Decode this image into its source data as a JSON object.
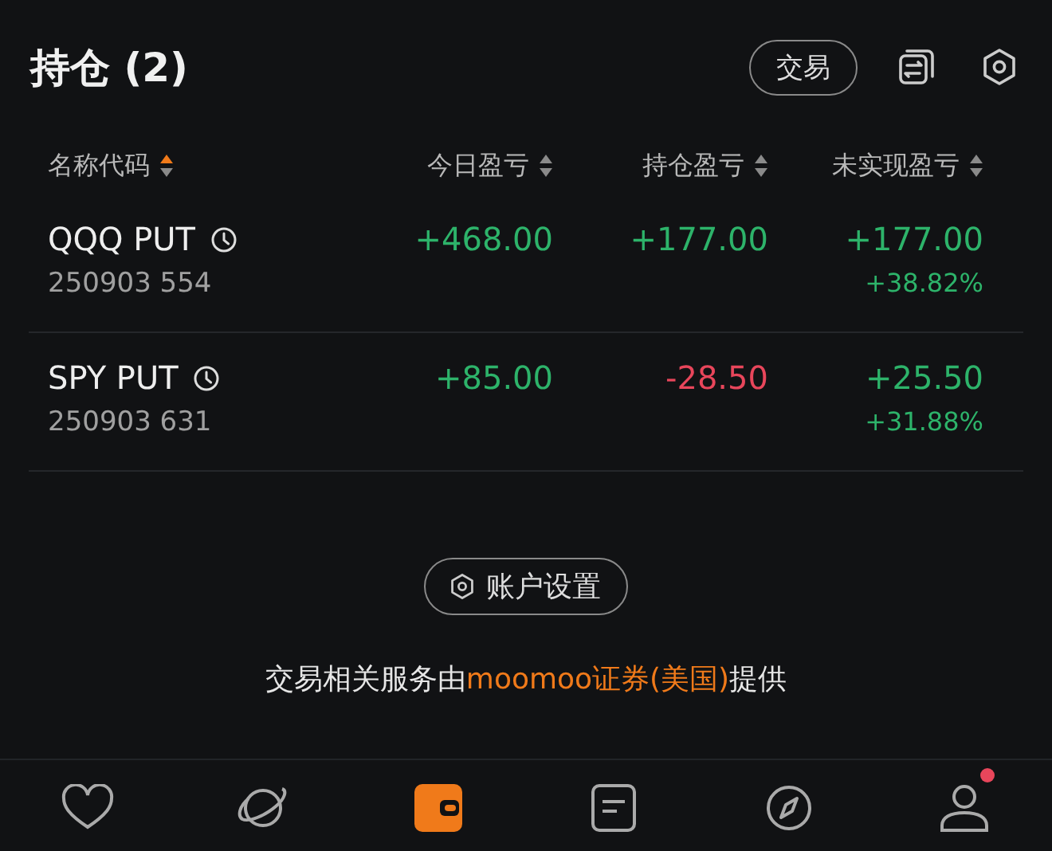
{
  "header": {
    "title": "持仓 (2)",
    "trade_button": "交易"
  },
  "columns": [
    {
      "label": "名称代码",
      "sorted": true
    },
    {
      "label": "今日盈亏",
      "sorted": false
    },
    {
      "label": "持仓盈亏",
      "sorted": false
    },
    {
      "label": "未实现盈亏",
      "sorted": false
    }
  ],
  "rows": [
    {
      "name": "QQQ PUT",
      "code": "250903 554",
      "today": {
        "text": "+468.00",
        "color": "#2db36a"
      },
      "position": {
        "text": "+177.00",
        "color": "#2db36a"
      },
      "unrealized": {
        "text": "+177.00",
        "color": "#2db36a"
      },
      "unrealized_pct": {
        "text": "+38.82%",
        "color": "#2db36a"
      }
    },
    {
      "name": "SPY PUT",
      "code": "250903 631",
      "today": {
        "text": "+85.00",
        "color": "#2db36a"
      },
      "position": {
        "text": "-28.50",
        "color": "#e8465b"
      },
      "unrealized": {
        "text": "+25.50",
        "color": "#2db36a"
      },
      "unrealized_pct": {
        "text": "+31.88%",
        "color": "#2db36a"
      }
    }
  ],
  "settings_button": "账户设置",
  "provider_parts": [
    {
      "text": "交易相关服务由",
      "highlight": false
    },
    {
      "text": "moomoo证券(美国)",
      "highlight": true
    },
    {
      "text": "提供",
      "highlight": false
    }
  ],
  "nav": [
    {
      "kind": "heart",
      "selected": false,
      "badge": false
    },
    {
      "kind": "planet",
      "selected": false,
      "badge": false
    },
    {
      "kind": "wallet",
      "selected": true,
      "badge": false
    },
    {
      "kind": "news",
      "selected": false,
      "badge": false
    },
    {
      "kind": "compass",
      "selected": false,
      "badge": false
    },
    {
      "kind": "person",
      "selected": false,
      "badge": true
    }
  ]
}
